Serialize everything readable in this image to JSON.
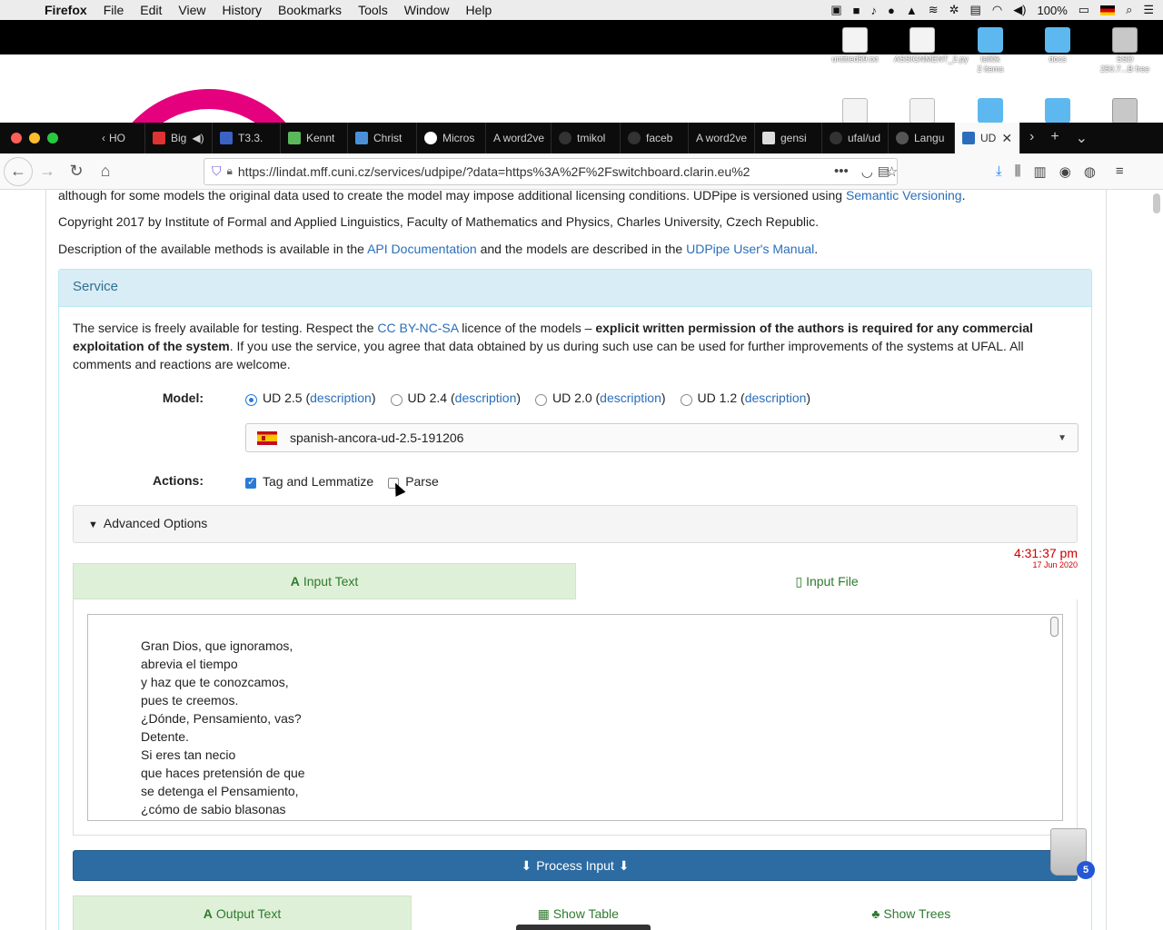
{
  "menubar": {
    "app": "Firefox",
    "items": [
      "File",
      "Edit",
      "View",
      "History",
      "Bookmarks",
      "Tools",
      "Window",
      "Help"
    ],
    "battery": "100%"
  },
  "desktop": {
    "icons": [
      {
        "label": "untitled59.txt",
        "kind": "doc"
      },
      {
        "label": "ASSIGNMENT_2.py",
        "kind": "doc"
      },
      {
        "label": "tell0k\n2 items",
        "kind": "folder"
      },
      {
        "label": "docs",
        "kind": "folder"
      },
      {
        "label": "SSD\n250.7...B free",
        "kind": "drive"
      }
    ]
  },
  "tabs": [
    {
      "title": "HO",
      "color": "#888"
    },
    {
      "title": "Big",
      "color": "#d33"
    },
    {
      "title": "T3.3.",
      "color": "#3b63c4"
    },
    {
      "title": "Kennt",
      "color": "#5bb85b"
    },
    {
      "title": "Christ",
      "color": "#4a90d9"
    },
    {
      "title": "Micros",
      "color": "#fff"
    },
    {
      "title": "A word2ve",
      "color": "#0c0c0d"
    },
    {
      "title": "tmikol",
      "color": "#333"
    },
    {
      "title": "faceb",
      "color": "#333"
    },
    {
      "title": "A word2ve",
      "color": "#0c0c0d"
    },
    {
      "title": "gensi",
      "color": "#ddd"
    },
    {
      "title": "ufal/ud",
      "color": "#333"
    },
    {
      "title": "Langu",
      "color": "#555"
    },
    {
      "title": "UD",
      "color": "#2a6ebb",
      "active": true
    }
  ],
  "url": "https://lindat.mff.cuni.cz/services/udpipe/?data=https%3A%2F%2Fswitchboard.clarin.eu%2",
  "page": {
    "line1_pre": "although for some models the original data used to create the model may impose additional licensing conditions. UDPipe is versioned using ",
    "line1_link": "Semantic Versioning",
    "line1_post": ".",
    "copyright": "Copyright 2017 by Institute of Formal and Applied Linguistics, Faculty of Mathematics and Physics, Charles University, Czech Republic.",
    "desc_pre": "Description of the available methods is available in the ",
    "desc_link1": "API Documentation",
    "desc_mid": " and the models are described in the ",
    "desc_link2": "UDPipe User's Manual",
    "desc_post": "."
  },
  "service": {
    "heading": "Service",
    "notice_pre": "The service is freely available for testing. Respect the ",
    "notice_link": "CC BY-NC-SA",
    "notice_mid": " licence of the models – ",
    "notice_bold": "explicit written permission of the authors is required for any commercial exploitation of the system",
    "notice_post": ". If you use the service, you agree that data obtained by us during such use can be used for further improvements of the systems at UFAL. All comments and reactions are welcome.",
    "model_label": "Model:",
    "models": [
      {
        "name": "UD 2.5",
        "checked": true
      },
      {
        "name": "UD 2.4",
        "checked": false
      },
      {
        "name": "UD 2.0",
        "checked": false
      },
      {
        "name": "UD 1.2",
        "checked": false
      }
    ],
    "description_link": "description",
    "selected_model": "spanish-ancora-ud-2.5-191206",
    "actions_label": "Actions:",
    "action_tag": "Tag and Lemmatize",
    "action_parse": "Parse",
    "advanced": "Advanced Options",
    "time": "4:31:37 pm",
    "date": "17 Jun 2020",
    "input_text_tab": "Input Text",
    "input_file_tab": "Input File",
    "input_lines": [
      "Gran Dios, que ignoramos,",
      "abrevia el tiempo",
      "y haz que te conozcamos,",
      "pues te creemos.",
      "¿Dónde, Pensamiento, vas?",
      "Detente.",
      "Si eres tan necio",
      "que haces pretensión de que",
      "se detenga el Pensamiento,",
      "¿cómo de sabio blasonas"
    ],
    "process_button": "Process Input",
    "output_text_tab": "Output Text",
    "show_table_tab": "Show Table",
    "show_trees_tab": "Show Trees"
  },
  "trash_badge": "5"
}
